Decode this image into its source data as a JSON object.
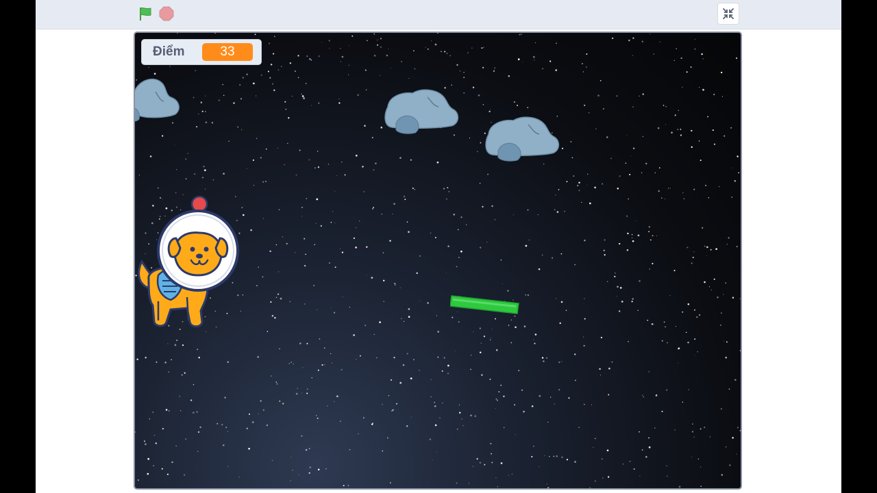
{
  "toolbar": {
    "green_flag_icon": "green-flag-icon",
    "stop_icon": "stop-sign-icon",
    "fullscreen_icon": "shrink-screen-icon"
  },
  "stage": {
    "background": "starry-night-sky",
    "score_monitor": {
      "label": "Điểm",
      "value": "33"
    },
    "sprites": [
      "rock",
      "rock",
      "rock",
      "dog-astronaut",
      "green-laser-bar"
    ]
  },
  "colors": {
    "toolbar_bg": "#e6ebf3",
    "flag_green": "#4cbf56",
    "stop_red": "#ec5959",
    "monitor_value_bg": "#ff8c1a",
    "rock_fill": "#8fb0c7",
    "dog_orange": "#ffab19",
    "laser_green": "#2fc93f"
  }
}
